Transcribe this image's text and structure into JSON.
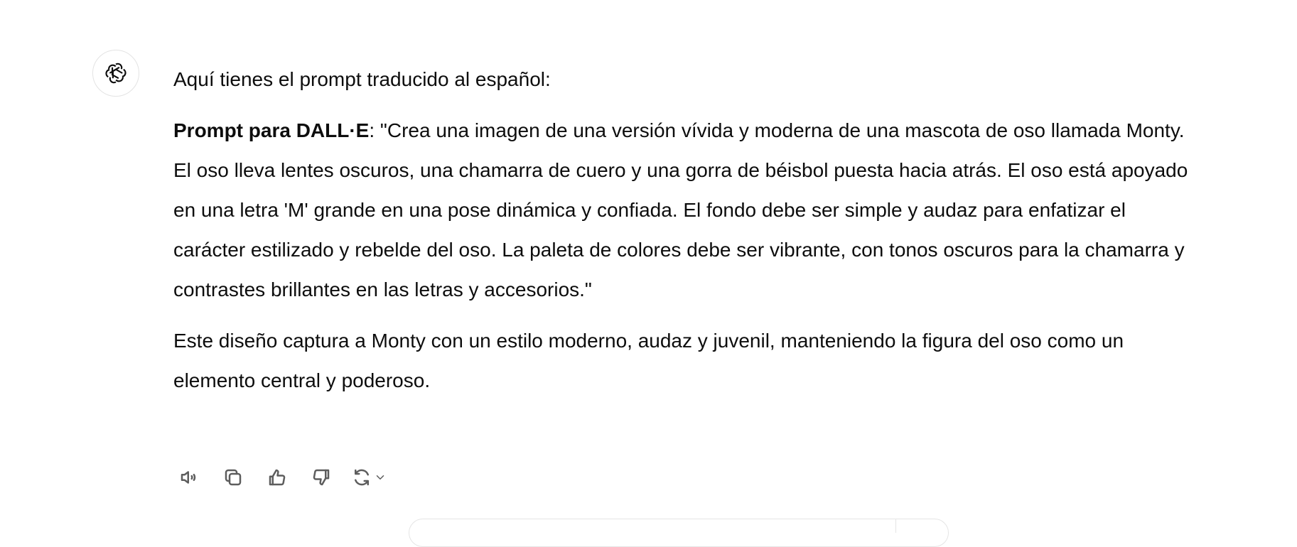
{
  "message": {
    "intro": "Aquí tienes el prompt traducido al español:",
    "prompt_label": "Prompt para DALL·E",
    "prompt_text": ": \"Crea una imagen de una versión vívida y moderna de una mascota de oso llamada Monty. El oso lleva lentes oscuros, una chamarra de cuero y una gorra de béisbol puesta hacia atrás. El oso está apoyado en una letra 'M' grande en una pose dinámica y confiada. El fondo debe ser simple y audaz para enfatizar el carácter estilizado y rebelde del oso. La paleta de colores debe ser vibrante, con tonos oscuros para la chamarra y contrastes brillantes en las letras y accesorios.\"",
    "closing": "Este diseño captura a Monty con un estilo moderno, audaz y juvenil, manteniendo la figura del oso como un elemento central y poderoso."
  },
  "avatar": {
    "icon": "openai-logo-icon"
  },
  "actions": [
    {
      "icon": "speaker-icon"
    },
    {
      "icon": "copy-icon"
    },
    {
      "icon": "thumbs-up-icon"
    },
    {
      "icon": "thumbs-down-icon"
    },
    {
      "icon": "regenerate-icon"
    },
    {
      "icon": "chevron-down-icon"
    }
  ],
  "colors": {
    "text": "#0d0d0d",
    "icon": "#5d5d5d",
    "border": "#e3e3e3",
    "background": "#ffffff"
  }
}
